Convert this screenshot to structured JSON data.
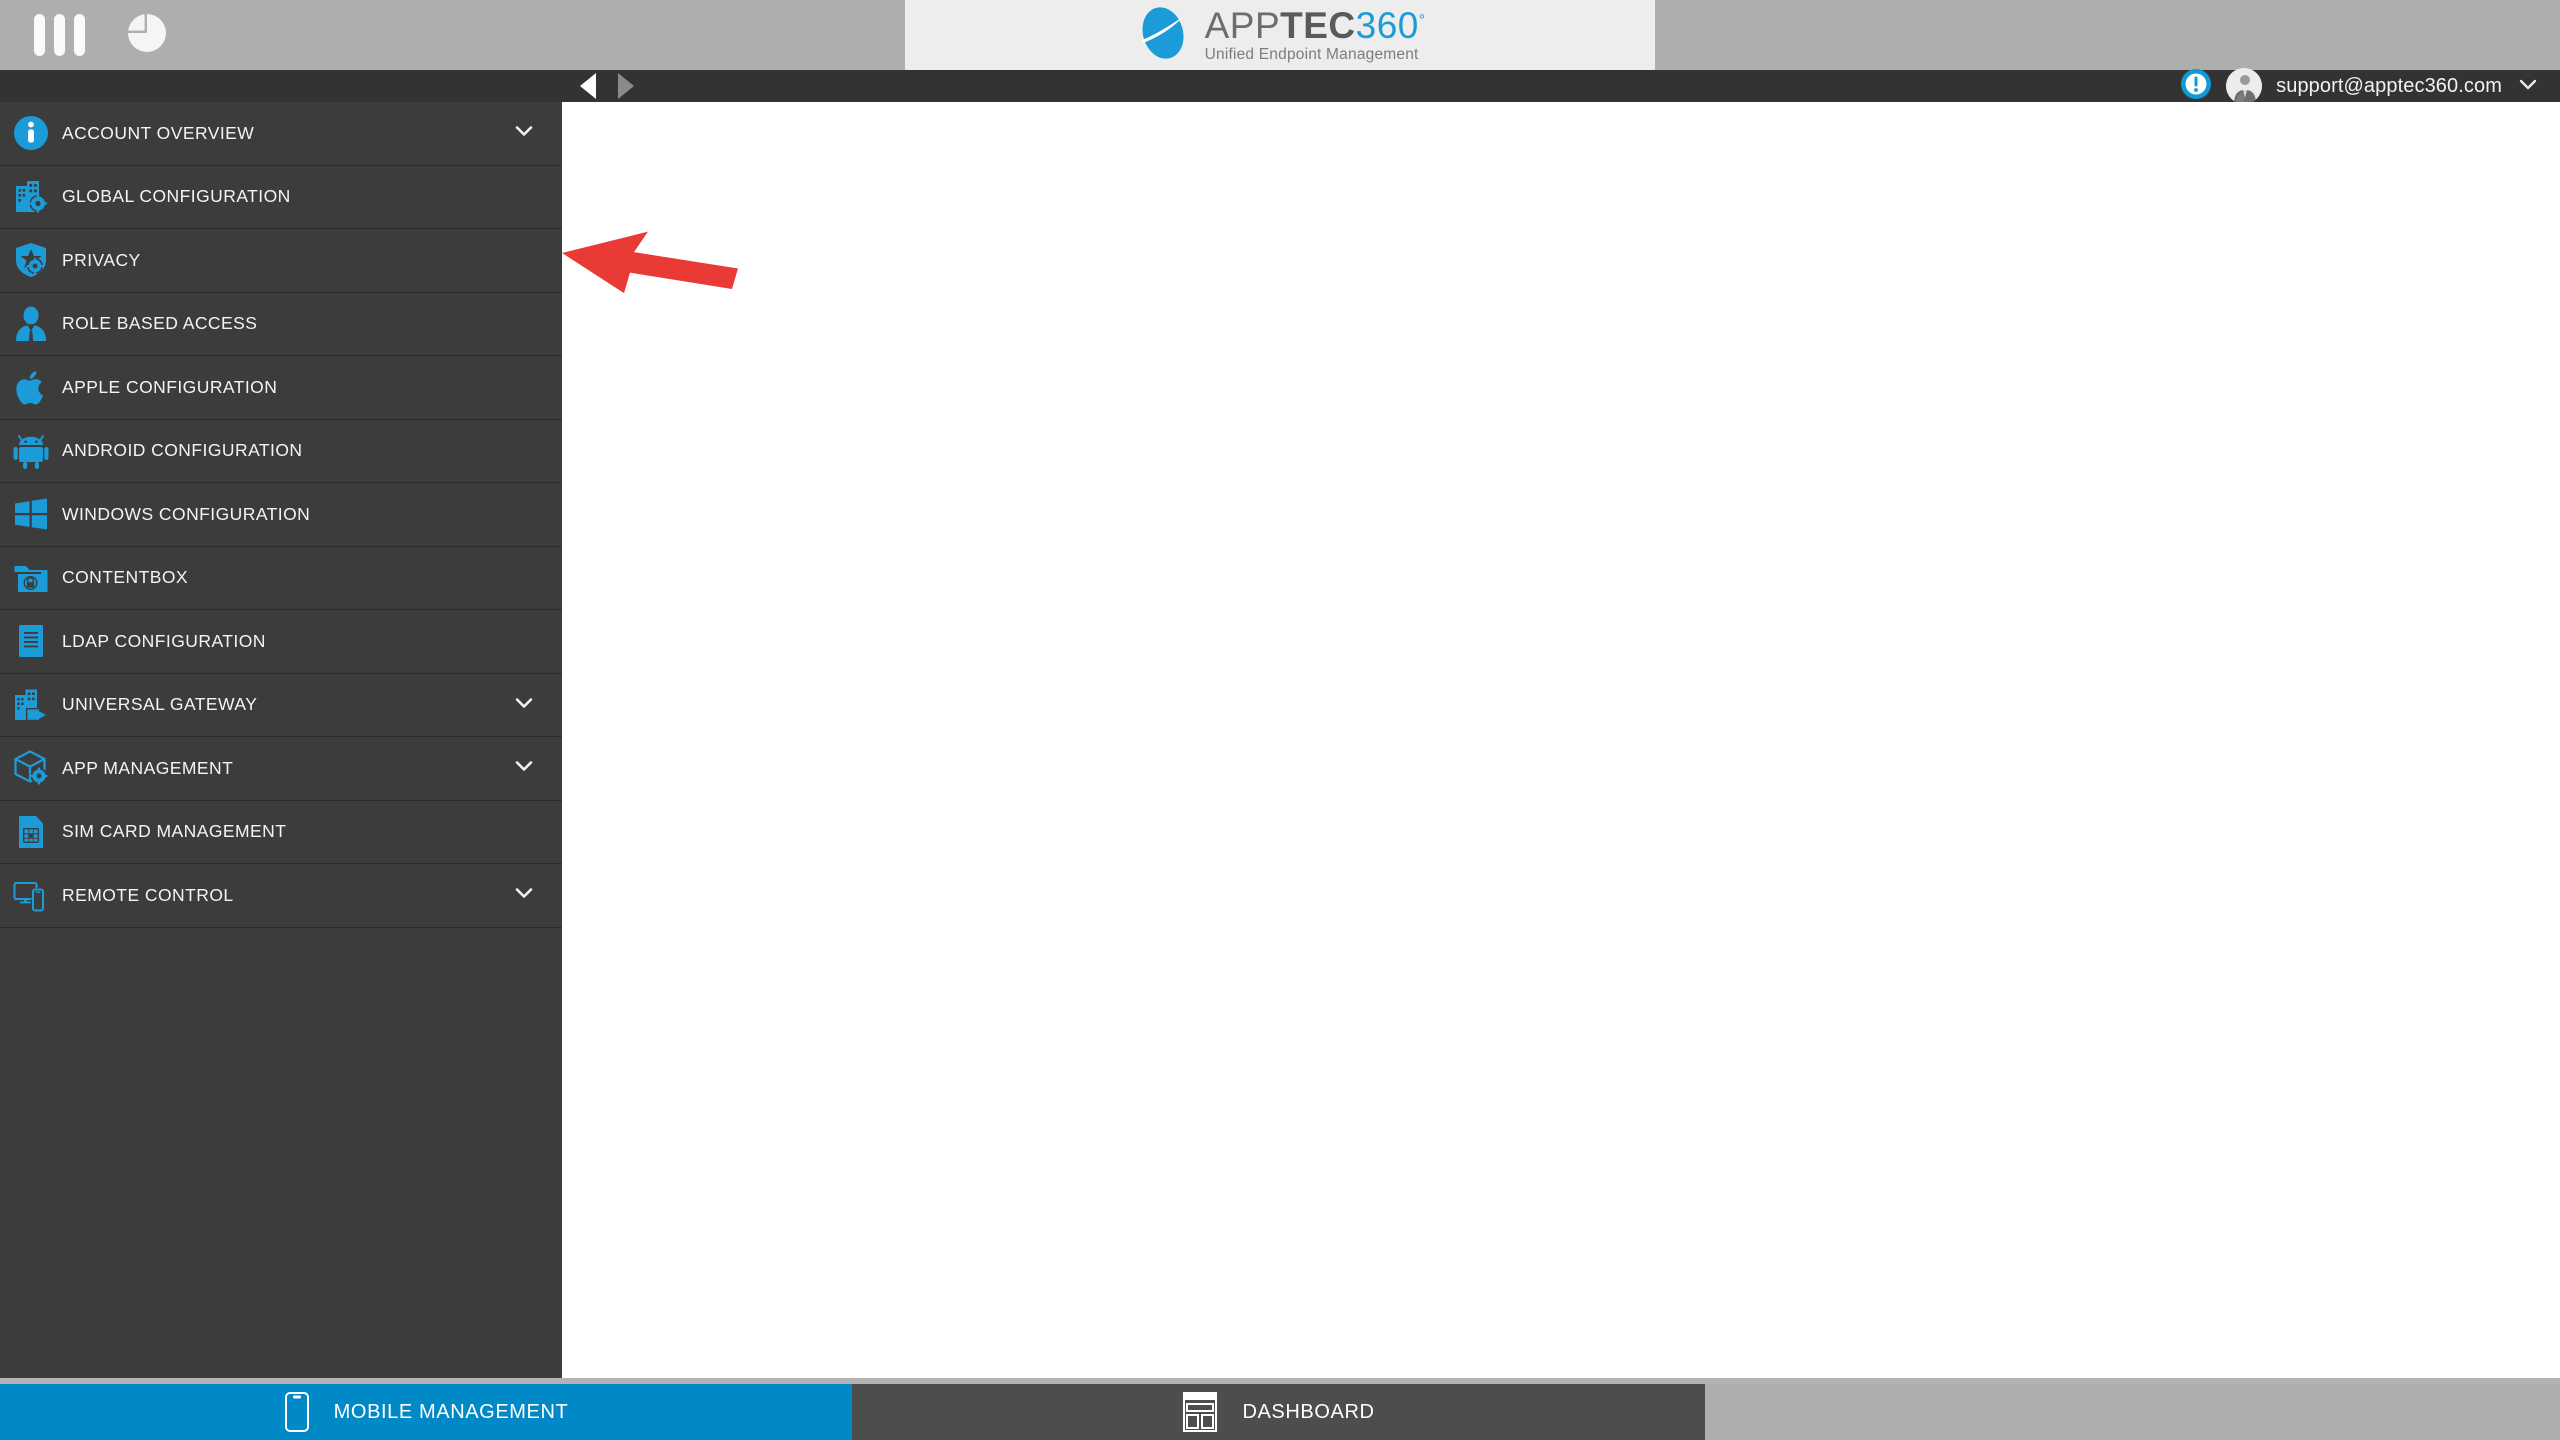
{
  "brandbar": {
    "menu_icon": "three-bars-icon",
    "pie_icon": "pie-chart-icon",
    "logo": {
      "word_app": "APP",
      "word_tec": "TEC",
      "word_360": "360",
      "degree": "°",
      "subtitle": "Unified Endpoint Management",
      "mark": "blue-ellipse-logo-mark",
      "accent_color": "#1b9bd7",
      "panel_bg": "#ededed"
    },
    "bg_color": "#aeaeae"
  },
  "navbar": {
    "back_label": "Back",
    "forward_label": "Forward",
    "back_icon": "triangle-left-icon",
    "forward_icon": "triangle-right-icon",
    "back_enabled": "true",
    "forward_enabled": "false",
    "alert_icon": "exclamation-badge-icon",
    "avatar_icon": "user-avatar",
    "user_email": "support@apptec360.com",
    "dropdown_icon": "chevron-down-icon",
    "bg_color": "#333333"
  },
  "sidebar": {
    "bg_color": "#3c3c3c",
    "icon_color": "#1b9bd7",
    "items": [
      {
        "label": "ACCOUNT OVERVIEW",
        "icon": "info-circle-icon",
        "expandable": true
      },
      {
        "label": "GLOBAL CONFIGURATION",
        "icon": "building-gear-icon",
        "expandable": false
      },
      {
        "label": "PRIVACY",
        "icon": "shield-star-gear-icon",
        "expandable": false
      },
      {
        "label": "ROLE BASED ACCESS",
        "icon": "user-suit-icon",
        "expandable": false
      },
      {
        "label": "APPLE CONFIGURATION",
        "icon": "apple-icon",
        "expandable": false
      },
      {
        "label": "ANDROID CONFIGURATION",
        "icon": "android-icon",
        "expandable": false
      },
      {
        "label": "WINDOWS CONFIGURATION",
        "icon": "windows-icon",
        "expandable": false
      },
      {
        "label": "CONTENTBOX",
        "icon": "folder-lock-icon",
        "expandable": false
      },
      {
        "label": "LDAP CONFIGURATION",
        "icon": "document-lines-icon",
        "expandable": false
      },
      {
        "label": "UNIVERSAL GATEWAY",
        "icon": "building-arrow-icon",
        "expandable": true
      },
      {
        "label": "APP MANAGEMENT",
        "icon": "box-gear-icon",
        "expandable": true
      },
      {
        "label": "SIM CARD MANAGEMENT",
        "icon": "sim-card-icon",
        "expandable": false
      },
      {
        "label": "REMOTE CONTROL",
        "icon": "monitor-phone-icon",
        "expandable": true
      }
    ]
  },
  "annotation": {
    "arrow_icon": "red-pointer-arrow",
    "color": "#e93a36",
    "points_at": "ACCOUNT OVERVIEW"
  },
  "tabbar": {
    "bg_color": "#aeaeae",
    "tabs": [
      {
        "label": "MOBILE MANAGEMENT",
        "icon": "mobile-phone-icon",
        "active": true,
        "color": "#0089c6"
      },
      {
        "label": "DASHBOARD",
        "icon": "dashboard-layout-icon",
        "active": false,
        "color": "#4d4d4d"
      }
    ]
  }
}
